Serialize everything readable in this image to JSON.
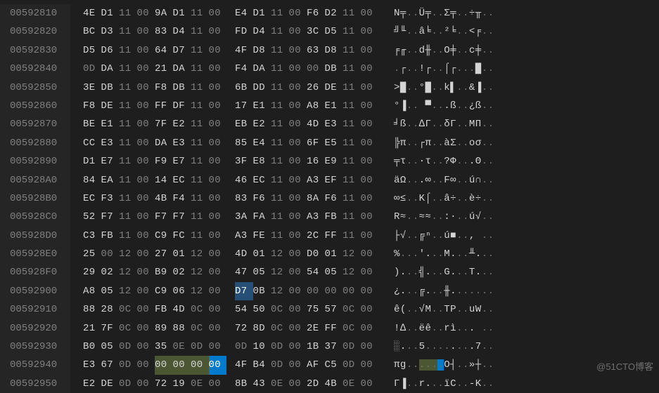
{
  "watermark": "@51CTO博客",
  "columns_per_row": 16,
  "group_split_after": 8,
  "rows": [
    {
      "address": "00592810",
      "bytes": [
        "4E",
        "D1",
        "11",
        "00",
        "9A",
        "D1",
        "11",
        "00",
        "E4",
        "D1",
        "11",
        "00",
        "F6",
        "D2",
        "11",
        "00"
      ],
      "ascii": "N╤..Ü╤..Σ╤..÷╥..",
      "highlights": []
    },
    {
      "address": "00592820",
      "bytes": [
        "BC",
        "D3",
        "11",
        "00",
        "83",
        "D4",
        "11",
        "00",
        "FD",
        "D4",
        "11",
        "00",
        "3C",
        "D5",
        "11",
        "00"
      ],
      "ascii": "╝╙..â╘..²╘..<╒..",
      "highlights": []
    },
    {
      "address": "00592830",
      "bytes": [
        "D5",
        "D6",
        "11",
        "00",
        "64",
        "D7",
        "11",
        "00",
        "4F",
        "D8",
        "11",
        "00",
        "63",
        "D8",
        "11",
        "00"
      ],
      "ascii": "╒╓..d╫..O╪..c╪..",
      "highlights": []
    },
    {
      "address": "00592840",
      "bytes": [
        "0D",
        "DA",
        "11",
        "00",
        "21",
        "DA",
        "11",
        "00",
        "F4",
        "DA",
        "11",
        "00",
        "00",
        "DB",
        "11",
        "00"
      ],
      "ascii": ".┌..!┌..⌠┌...█..",
      "highlights": []
    },
    {
      "address": "00592850",
      "bytes": [
        "3E",
        "DB",
        "11",
        "00",
        "F8",
        "DB",
        "11",
        "00",
        "6B",
        "DD",
        "11",
        "00",
        "26",
        "DE",
        "11",
        "00"
      ],
      "ascii": ">█..°█..k▌..&▐..",
      "highlights": []
    },
    {
      "address": "00592860",
      "bytes": [
        "F8",
        "DE",
        "11",
        "00",
        "FF",
        "DF",
        "11",
        "00",
        "17",
        "E1",
        "11",
        "00",
        "A8",
        "E1",
        "11",
        "00"
      ],
      "ascii": "°▐.. ▀...ß..¿ß..",
      "highlights": []
    },
    {
      "address": "00592870",
      "bytes": [
        "BE",
        "E1",
        "11",
        "00",
        "7F",
        "E2",
        "11",
        "00",
        "EB",
        "E2",
        "11",
        "00",
        "4D",
        "E3",
        "11",
        "00"
      ],
      "ascii": "╛ß..∆Γ..δΓ..MΠ..",
      "highlights": []
    },
    {
      "address": "00592880",
      "bytes": [
        "CC",
        "E3",
        "11",
        "00",
        "DA",
        "E3",
        "11",
        "00",
        "85",
        "E4",
        "11",
        "00",
        "6F",
        "E5",
        "11",
        "00"
      ],
      "ascii": "╠π..┌π..àΣ..oσ..",
      "highlights": []
    },
    {
      "address": "00592890",
      "bytes": [
        "D1",
        "E7",
        "11",
        "00",
        "F9",
        "E7",
        "11",
        "00",
        "3F",
        "E8",
        "11",
        "00",
        "16",
        "E9",
        "11",
        "00"
      ],
      "ascii": "╤τ..∙τ..?Φ...Θ..",
      "highlights": []
    },
    {
      "address": "005928A0",
      "bytes": [
        "84",
        "EA",
        "11",
        "00",
        "14",
        "EC",
        "11",
        "00",
        "46",
        "EC",
        "11",
        "00",
        "A3",
        "EF",
        "11",
        "00"
      ],
      "ascii": "äΩ...∞..F∞..ú∩..",
      "highlights": []
    },
    {
      "address": "005928B0",
      "bytes": [
        "EC",
        "F3",
        "11",
        "00",
        "4B",
        "F4",
        "11",
        "00",
        "83",
        "F6",
        "11",
        "00",
        "8A",
        "F6",
        "11",
        "00"
      ],
      "ascii": "∞≤..K⌠..â÷..è÷..",
      "highlights": []
    },
    {
      "address": "005928C0",
      "bytes": [
        "52",
        "F7",
        "11",
        "00",
        "F7",
        "F7",
        "11",
        "00",
        "3A",
        "FA",
        "11",
        "00",
        "A3",
        "FB",
        "11",
        "00"
      ],
      "ascii": "R≈..≈≈..:·..ú√..",
      "highlights": []
    },
    {
      "address": "005928D0",
      "bytes": [
        "C3",
        "FB",
        "11",
        "00",
        "C9",
        "FC",
        "11",
        "00",
        "A3",
        "FE",
        "11",
        "00",
        "2C",
        "FF",
        "11",
        "00"
      ],
      "ascii": "├√..╔ⁿ..ú■.., ..",
      "highlights": []
    },
    {
      "address": "005928E0",
      "bytes": [
        "25",
        "00",
        "12",
        "00",
        "27",
        "01",
        "12",
        "00",
        "4D",
        "01",
        "12",
        "00",
        "D0",
        "01",
        "12",
        "00"
      ],
      "ascii": "%...'...M...╨...",
      "highlights": []
    },
    {
      "address": "005928F0",
      "bytes": [
        "29",
        "02",
        "12",
        "00",
        "B9",
        "02",
        "12",
        "00",
        "47",
        "05",
        "12",
        "00",
        "54",
        "05",
        "12",
        "00"
      ],
      "ascii": ")...╣...G...T...",
      "highlights": []
    },
    {
      "address": "00592900",
      "bytes": [
        "A8",
        "05",
        "12",
        "00",
        "C9",
        "06",
        "12",
        "00",
        "D7",
        "0B",
        "12",
        "00",
        "00",
        "00",
        "00",
        "00"
      ],
      "ascii": "¿...╔...╫.......",
      "highlights": [
        {
          "index": 8,
          "class": "sel"
        }
      ]
    },
    {
      "address": "00592910",
      "bytes": [
        "88",
        "28",
        "0C",
        "00",
        "FB",
        "4D",
        "0C",
        "00",
        "54",
        "50",
        "0C",
        "00",
        "75",
        "57",
        "0C",
        "00"
      ],
      "ascii": "ê(..√M..TP..uW..",
      "highlights": []
    },
    {
      "address": "00592920",
      "bytes": [
        "21",
        "7F",
        "0C",
        "00",
        "89",
        "88",
        "0C",
        "00",
        "72",
        "8D",
        "0C",
        "00",
        "2E",
        "FF",
        "0C",
        "00"
      ],
      "ascii": "!∆..ëê..rì... ..",
      "highlights": []
    },
    {
      "address": "00592930",
      "bytes": [
        "B0",
        "05",
        "0D",
        "00",
        "35",
        "0E",
        "0D",
        "00",
        "0D",
        "10",
        "0D",
        "00",
        "1B",
        "37",
        "0D",
        "00"
      ],
      "ascii": "░...5........7..",
      "highlights": []
    },
    {
      "address": "00592940",
      "bytes": [
        "E3",
        "67",
        "0D",
        "00",
        "00",
        "00",
        "00",
        "00",
        "4F",
        "B4",
        "0D",
        "00",
        "AF",
        "C5",
        "0D",
        "00"
      ],
      "ascii": "πg......O┤..»┼..",
      "highlights": [
        {
          "index": 4,
          "class": "hl-g"
        },
        {
          "index": 5,
          "class": "hl-g"
        },
        {
          "index": 6,
          "class": "hl-g"
        },
        {
          "index": 7,
          "class": "hl-c"
        }
      ],
      "ascii_highlights": [
        {
          "index": 4,
          "class": "hl-g"
        },
        {
          "index": 5,
          "class": "hl-g"
        },
        {
          "index": 6,
          "class": "hl-g"
        },
        {
          "index": 7,
          "class": "hl-c"
        }
      ]
    },
    {
      "address": "00592950",
      "bytes": [
        "E2",
        "DE",
        "0D",
        "00",
        "72",
        "19",
        "0E",
        "00",
        "8B",
        "43",
        "0E",
        "00",
        "2D",
        "4B",
        "0E",
        "00"
      ],
      "ascii": "Γ▐..r...ïC..-K..",
      "highlights": []
    }
  ]
}
